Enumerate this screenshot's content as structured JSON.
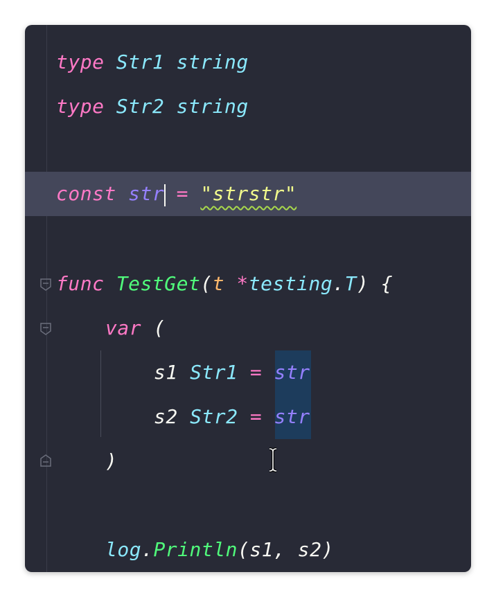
{
  "editor": {
    "lines": [
      {
        "tokens": [
          "type",
          " ",
          "Str1",
          " ",
          "string"
        ]
      },
      {
        "tokens": [
          "type",
          " ",
          "Str2",
          " ",
          "string"
        ]
      },
      {
        "tokens": [
          "const",
          " ",
          "str",
          " ",
          "=",
          " ",
          "\"strstr\""
        ]
      },
      {
        "tokens": [
          "func",
          " ",
          "TestGet",
          "(",
          "t",
          " ",
          "*",
          "testing",
          ".",
          "T",
          ")",
          " ",
          "{"
        ]
      },
      {
        "tokens": [
          "var",
          " ",
          "("
        ]
      },
      {
        "tokens": [
          "s1",
          " ",
          "Str1",
          " ",
          "=",
          " ",
          "str"
        ]
      },
      {
        "tokens": [
          "s2",
          " ",
          "Str2",
          " ",
          "=",
          " ",
          "str"
        ]
      },
      {
        "tokens": [
          ")"
        ]
      },
      {
        "tokens": [
          "log",
          ".",
          "Println",
          "(s1, s2)"
        ]
      }
    ]
  },
  "colors": {
    "background": "#282a36",
    "current_line": "#44475a",
    "keyword": "#ff79c6",
    "type": "#8be9fd",
    "function": "#50fa7b",
    "variable": "#9580ff",
    "string": "#f1fa8c",
    "selection_highlight": "#1d3c5c"
  },
  "icons": [
    "fold-icon",
    "fold-end-icon",
    "text-cursor-icon"
  ]
}
